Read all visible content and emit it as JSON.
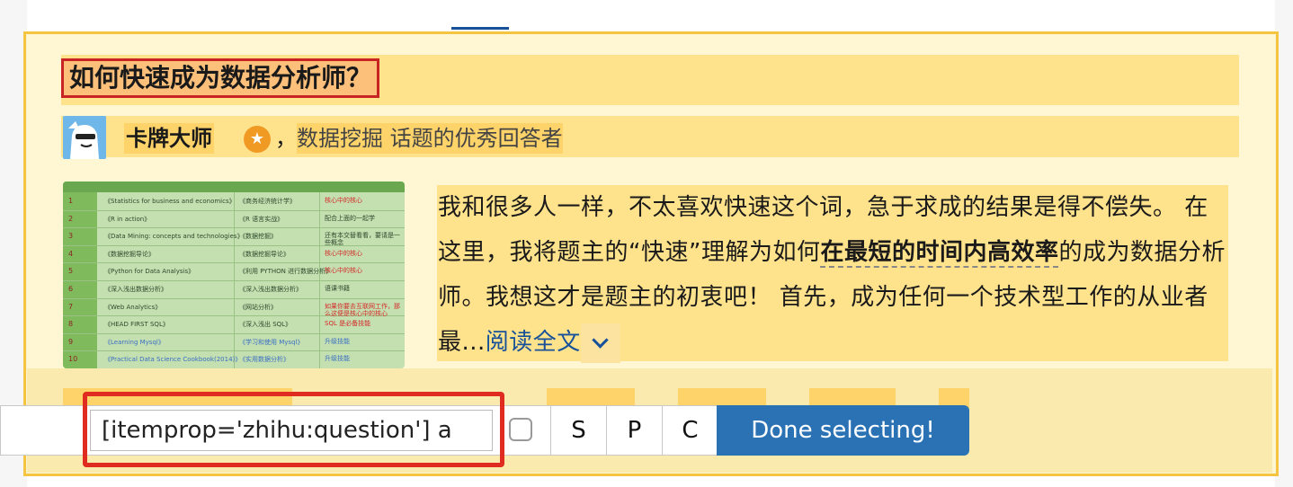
{
  "question": {
    "title": "如何快速成为数据分析师？"
  },
  "author": {
    "name": "卡牌大师",
    "comma": "，",
    "headline": "数据挖掘 话题的优秀回答者"
  },
  "thumbnail": {
    "rows": [
      {
        "num": "1",
        "a": "《Statistics for business and economics》",
        "b": "《商务经济统计学》",
        "c": "核心中的核心",
        "c_color": "red"
      },
      {
        "num": "2",
        "a": "《R in action》",
        "b": "《R 语言实战》",
        "c": "配合上面的一起学",
        "c_color": "dark"
      },
      {
        "num": "3",
        "a": "《Data Mining: concepts and technologies》",
        "b": "《数据挖掘》",
        "c": "还有本交替看看，要请是一些概念",
        "c_color": "dark"
      },
      {
        "num": "4",
        "a": "《数据挖掘导论》",
        "b": "《数据挖掘导论》",
        "c": "核心中的核心",
        "c_color": "red"
      },
      {
        "num": "5",
        "a": "《Python for Data Analysis》",
        "b": "《利用 PYTHON 进行数据分析》",
        "c": "核心中的核心",
        "c_color": "red"
      },
      {
        "num": "6",
        "a": "《深入浅出数据分析》",
        "b": "《深入浅出数据分析》",
        "c": "语课书籍",
        "c_color": "dark"
      },
      {
        "num": "7",
        "a": "《Web Analytics》",
        "b": "《网站分析》",
        "c": "如果你要去互联网工作，那么这便是核心中的核心",
        "c_color": "red"
      },
      {
        "num": "8",
        "a": "《HEAD FIRST SQL》",
        "b": "《深入浅出 SQL》",
        "c": "SQL 是必备技能",
        "c_color": "red"
      },
      {
        "num": "9",
        "a": "《Learning Mysql》",
        "b": "《学习和使用 Mysql》",
        "c": "升级技能",
        "c_color": "blue"
      },
      {
        "num": "10",
        "a": "《Practical Data Science Cookbook(2014)》",
        "b": "《实用数据分析》",
        "c": "升级技能",
        "c_color": "blue"
      }
    ]
  },
  "excerpt": {
    "part1": "我和很多人一样，不太喜欢快速这个词，急于求成的结果是得不偿失。 在这里，我将题主的“快速”理解为如何",
    "emphasis": "在最短的时间内高效率",
    "part2": "的成为数据分析师。我想这才是题主的初衷吧！ 首先，成为任何一个技术型工作的从业者最...",
    "read_more": "阅读全文"
  },
  "selector_gadget": {
    "input_value": "[itemprop='zhihu:question'] a",
    "button_s": "S",
    "button_p": "P",
    "button_c": "C",
    "done_label": "Done selecting!"
  },
  "colors": {
    "highlight_frame": "#f5c542",
    "focus_red": "#e02b20",
    "done_button": "#2b72b5",
    "link_blue": "#175199"
  }
}
